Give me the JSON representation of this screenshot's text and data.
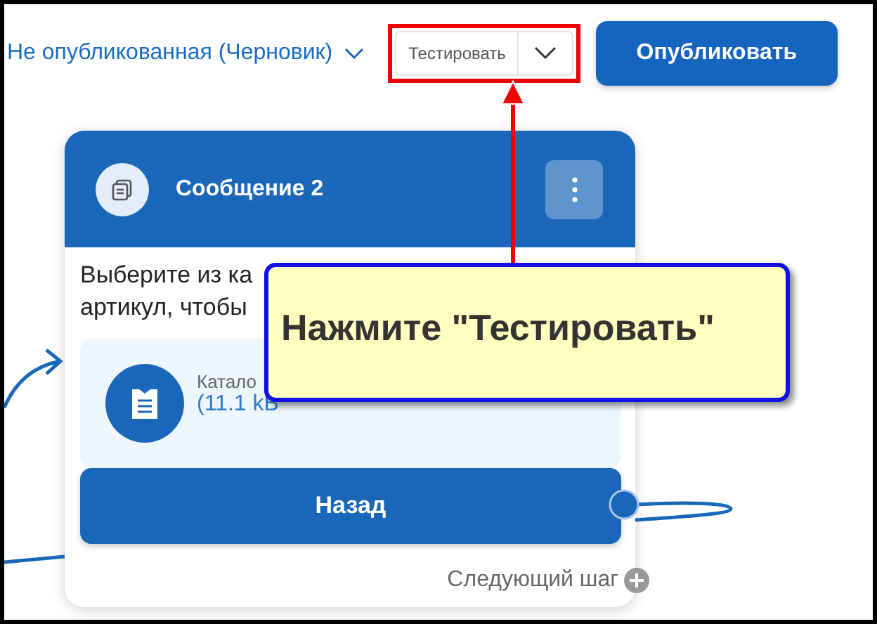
{
  "top_bar": {
    "status": "Не опубликованная (Черновик)",
    "test_button": "Тестировать",
    "publish_button": "Опубликовать"
  },
  "card": {
    "title": "Сообщение 2",
    "text_lines": [
      "Выберите из ка",
      "артикул, чтобы"
    ],
    "attachment": {
      "name": "Катало",
      "size": "(11.1 kB"
    },
    "back_button": "Назад",
    "next_step": "Следующий шаг"
  },
  "callout": {
    "text": "Нажмите \"Тестировать\""
  }
}
